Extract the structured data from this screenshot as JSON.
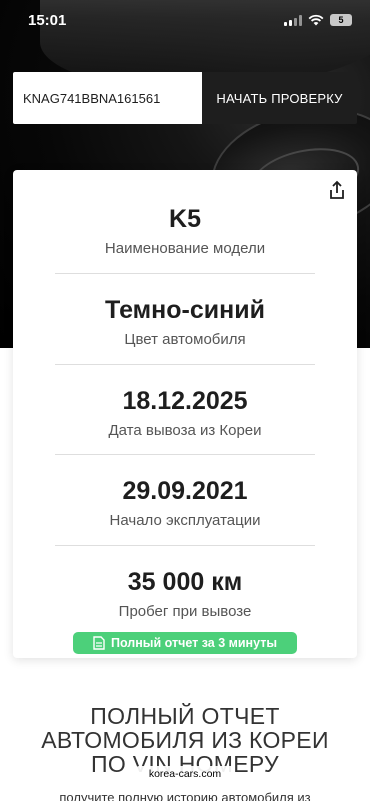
{
  "status_bar": {
    "time": "15:01",
    "battery": "5"
  },
  "search": {
    "vin_value": "KNAG741BBNA161561",
    "button_label": "НАЧАТЬ ПРОВЕРКУ"
  },
  "card": {
    "share_icon": "share-icon",
    "rows": [
      {
        "value": "K5",
        "label": "Наименование модели"
      },
      {
        "value": "Темно-синий",
        "label": "Цвет автомобиля"
      },
      {
        "value": "18.12.2025",
        "label": "Дата вывоза из Кореи"
      },
      {
        "value": "29.09.2021",
        "label": "Начало эксплуатации"
      },
      {
        "value": "35 000 км",
        "label": "Пробег при вывозе"
      }
    ],
    "report_badge": "Полный отчет за 3 минуты",
    "badge_color": "#4cd07a"
  },
  "promo": {
    "headline_lines": [
      "ПОЛНЫЙ ОТЧЕТ",
      "АВТОМОБИЛЯ ИЗ КОРЕИ",
      "ПО VIN НОМЕРУ"
    ],
    "site": "korea-cars.com",
    "subline": "получите полную историю автомобиля из"
  },
  "colors": {
    "hero_bg": "#000000",
    "button_bg": "#1e1e1e",
    "text": "#1e1e1e"
  }
}
